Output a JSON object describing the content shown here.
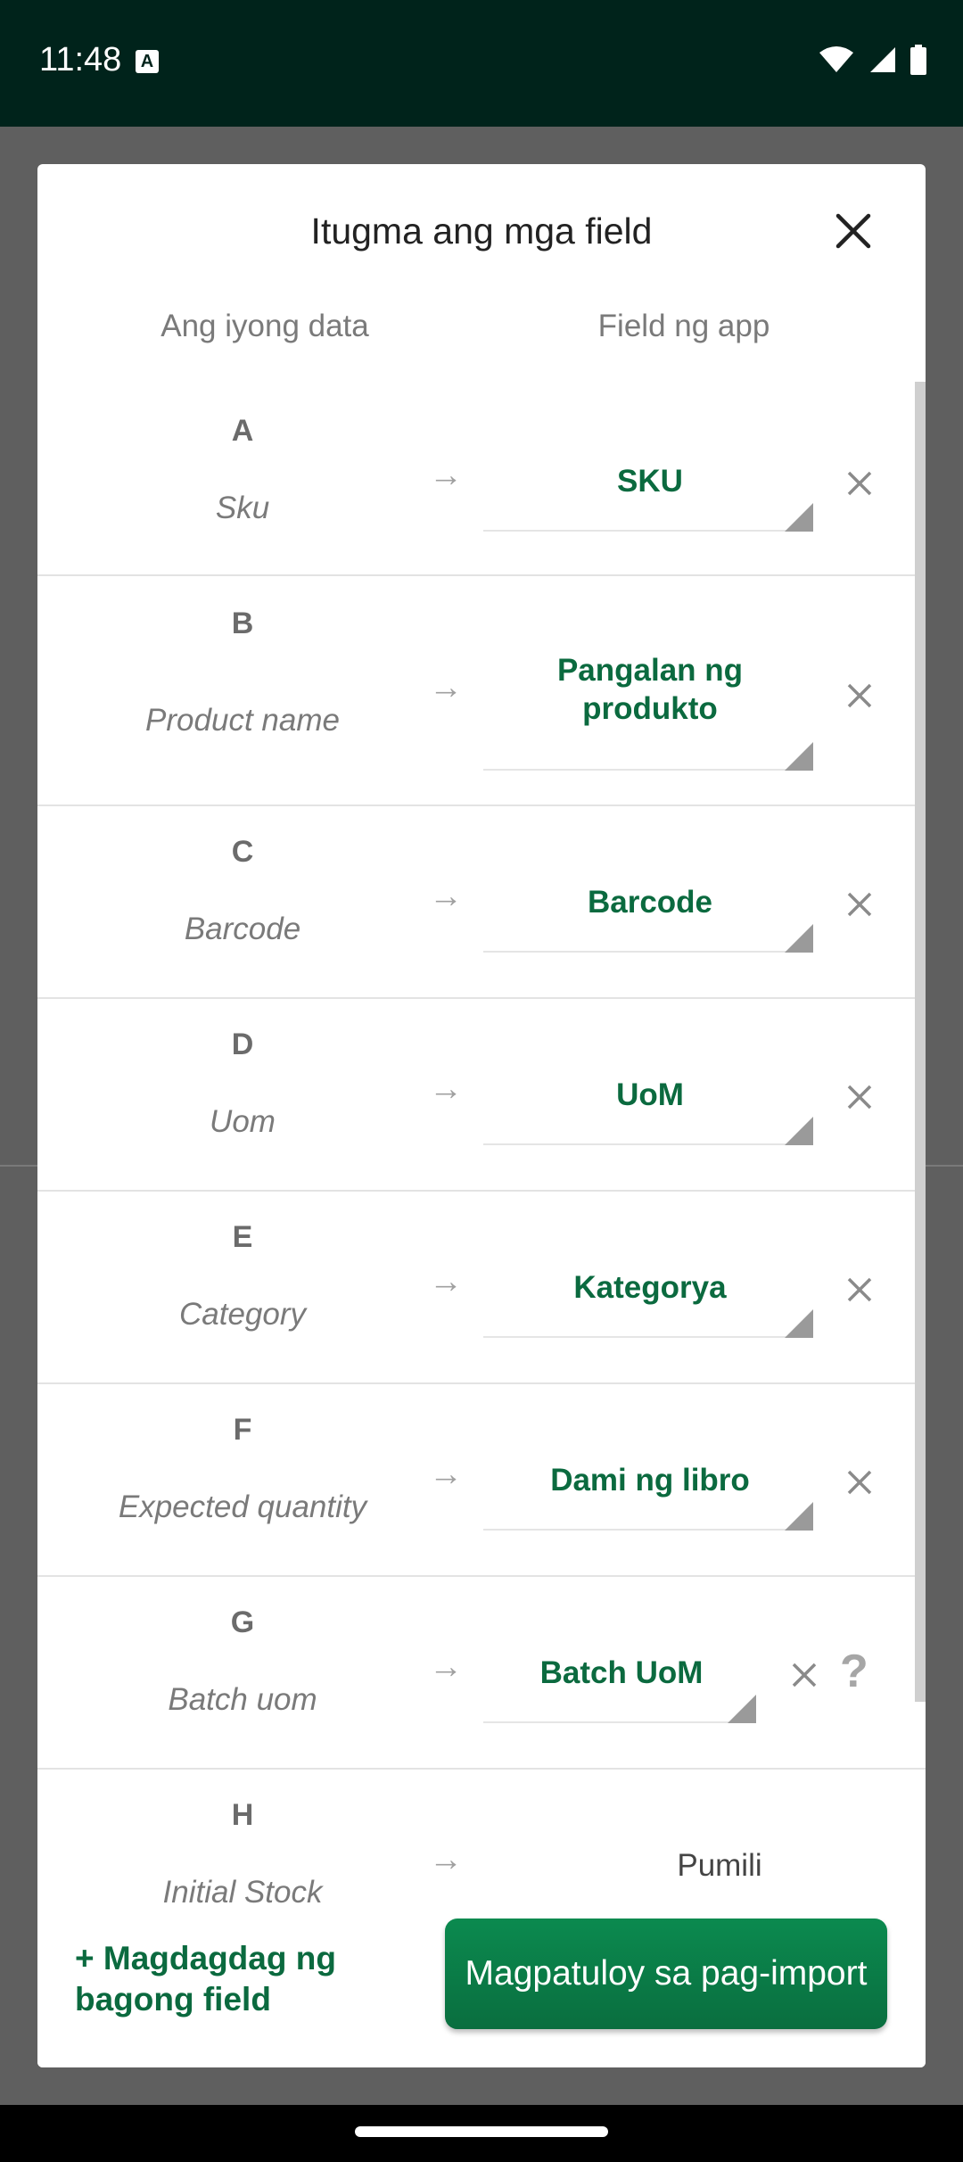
{
  "status": {
    "time": "11:48"
  },
  "dialog": {
    "title": "Itugma ang mga field",
    "col_left": "Ang iyong data",
    "col_right": "Field ng app",
    "rows": [
      {
        "letter": "A",
        "source": "Sku",
        "field": "SKU"
      },
      {
        "letter": "B",
        "source": "Product name",
        "field": "Pangalan ng produkto"
      },
      {
        "letter": "C",
        "source": "Barcode",
        "field": "Barcode"
      },
      {
        "letter": "D",
        "source": "Uom",
        "field": "UoM"
      },
      {
        "letter": "E",
        "source": "Category",
        "field": "Kategorya"
      },
      {
        "letter": "F",
        "source": "Expected quantity",
        "field": "Dami ng libro"
      },
      {
        "letter": "G",
        "source": "Batch uom",
        "field": "Batch UoM",
        "help": "?"
      },
      {
        "letter": "H",
        "source": "Initial Stock",
        "field": "Pumili"
      }
    ],
    "arrow": "→"
  },
  "footer": {
    "add_field": "+ Magdagdag ng bagong field",
    "continue": "Magpatuloy sa pag-import"
  },
  "colors": {
    "brand": "#0b6a3f",
    "button": "#0b7a46",
    "statusbar": "#00231b"
  }
}
